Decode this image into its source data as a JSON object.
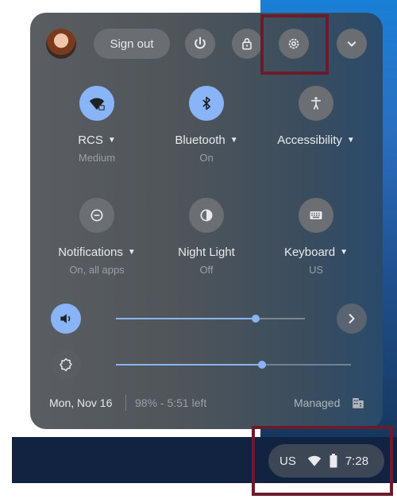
{
  "colors": {
    "accent": "#8ab4f8",
    "highlight_border": "#6b1c2a",
    "shelf": "#122341"
  },
  "header": {
    "signout_label": "Sign out",
    "icons": [
      "power-icon",
      "lock-icon",
      "settings-icon",
      "collapse-chevron-icon"
    ]
  },
  "features": [
    {
      "label": "RCS",
      "sub": "Medium",
      "icon": "wifi-lock-icon",
      "active": true,
      "has_menu": true
    },
    {
      "label": "Bluetooth",
      "sub": "On",
      "icon": "bluetooth-icon",
      "active": true,
      "has_menu": true
    },
    {
      "label": "Accessibility",
      "sub": "",
      "icon": "accessibility-icon",
      "active": false,
      "has_menu": true
    },
    {
      "label": "Notifications",
      "sub": "On, all apps",
      "icon": "notifications-icon",
      "active": false,
      "has_menu": true
    },
    {
      "label": "Night Light",
      "sub": "Off",
      "icon": "night-light-icon",
      "active": false,
      "has_menu": false
    },
    {
      "label": "Keyboard",
      "sub": "US",
      "icon": "keyboard-icon",
      "active": false,
      "has_menu": true
    }
  ],
  "sliders": {
    "volume": {
      "icon": "volume-icon",
      "level": 0.74
    },
    "brightness": {
      "icon": "brightness-icon",
      "level": 0.62
    }
  },
  "footer": {
    "date": "Mon, Nov 16",
    "battery": "98% - 5:51 left",
    "managed": "Managed",
    "managed_icon": "managed-building-icon"
  },
  "tray": {
    "ime": "US",
    "time": "7:28",
    "icons": [
      "wifi-icon",
      "battery-icon"
    ]
  }
}
